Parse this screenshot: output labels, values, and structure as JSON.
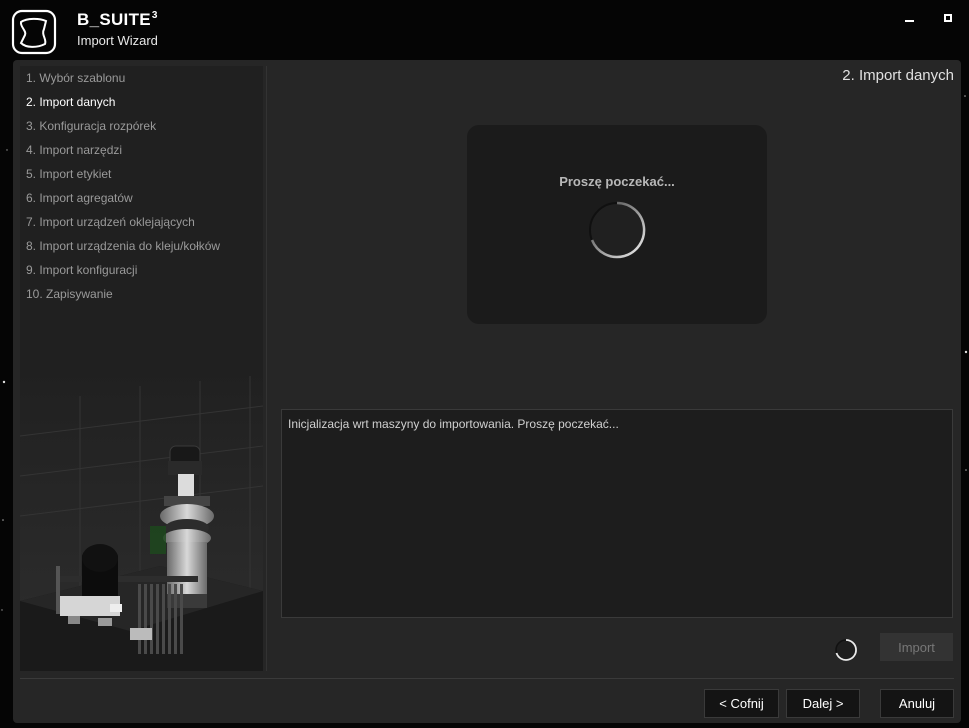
{
  "app": {
    "name": "B_SUITE",
    "name_sup": "3",
    "subtitle": "Import Wizard"
  },
  "steps": [
    {
      "label": "1. Wybór szablonu",
      "active": false
    },
    {
      "label": "2. Import danych",
      "active": true
    },
    {
      "label": "3. Konfiguracja rozpórek",
      "active": false
    },
    {
      "label": "4. Import narzędzi",
      "active": false
    },
    {
      "label": "5. Import etykiet",
      "active": false
    },
    {
      "label": "6. Import agregatów",
      "active": false
    },
    {
      "label": "7. Import urządzeń oklejających",
      "active": false
    },
    {
      "label": "8. Import urządzenia do kleju/kołków",
      "active": false
    },
    {
      "label": "9. Import konfiguracji",
      "active": false
    },
    {
      "label": "10. Zapisywanie",
      "active": false
    }
  ],
  "main": {
    "page_title": "2. Import danych",
    "wait_text": "Proszę poczekać...",
    "log_text": "Inicjalizacja wrt maszyny do importowania. Proszę poczekać...",
    "import_label": "Import"
  },
  "footer": {
    "back_label": "< Cofnij",
    "next_label": "Dalej >",
    "cancel_label": "Anuluj"
  },
  "icons": {
    "logo": "b-suite-logo-icon",
    "minimize": "minimize-icon",
    "maximize": "maximize-icon",
    "spinner": "spinner-icon"
  },
  "colors": {
    "background": "#050505",
    "panel": "#262626",
    "sidebar": "#202020",
    "active_step": "#ffffff",
    "inactive_step": "#9a9a9a"
  }
}
